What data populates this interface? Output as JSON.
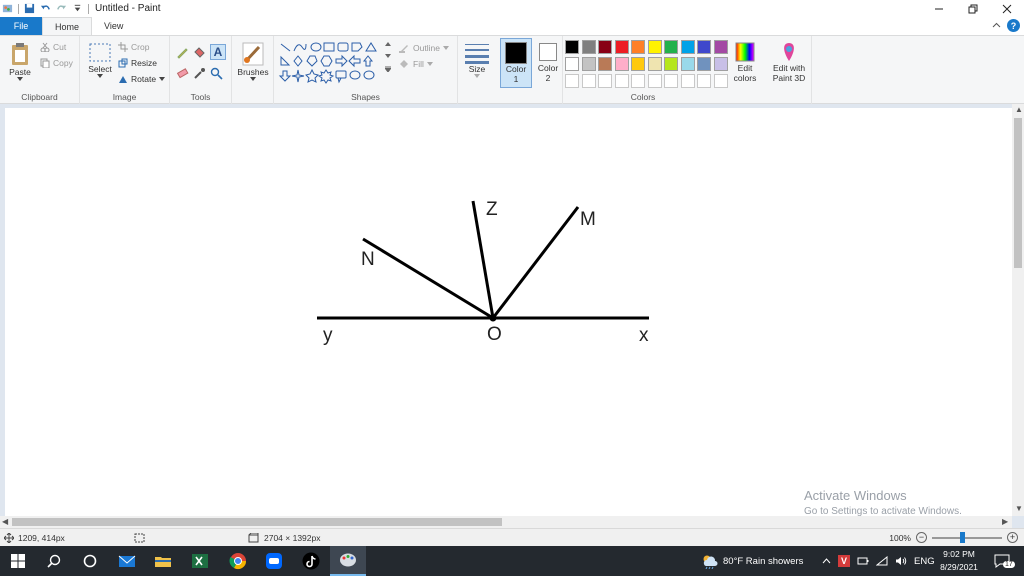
{
  "window": {
    "title": "Untitled - Paint",
    "controls": [
      "minimize-icon",
      "restore-icon",
      "close-icon"
    ]
  },
  "tabs": [
    {
      "label": "File"
    },
    {
      "label": "Home"
    },
    {
      "label": "View"
    }
  ],
  "ribbon": {
    "clipboard": {
      "paste": "Paste",
      "cut": "Cut",
      "copy": "Copy",
      "label": "Clipboard"
    },
    "image": {
      "select": "Select",
      "crop": "Crop",
      "resize": "Resize",
      "rotate": "Rotate",
      "label": "Image"
    },
    "tools": {
      "label": "Tools"
    },
    "brushes": {
      "label": "Brushes"
    },
    "shapes": {
      "outline": "Outline",
      "fill": "Fill",
      "label": "Shapes"
    },
    "size": {
      "label": "Size"
    },
    "color1": {
      "line1": "Color",
      "line2": "1",
      "color": "#000000"
    },
    "color2": {
      "line1": "Color",
      "line2": "2",
      "color": "#ffffff"
    },
    "colors": {
      "label": "Colors",
      "row1": [
        "#000000",
        "#7f7f7f",
        "#880015",
        "#ed1c24",
        "#ff7f27",
        "#fff200",
        "#22b14c",
        "#00a2e8",
        "#3f48cc",
        "#a349a4"
      ],
      "row2": [
        "#ffffff",
        "#c3c3c3",
        "#b97a57",
        "#ffaec9",
        "#ffc90e",
        "#efe4b0",
        "#b5e61d",
        "#99d9ea",
        "#7092be",
        "#c8bfe7"
      ]
    },
    "edit_colors": {
      "line1": "Edit",
      "line2": "colors"
    },
    "paint3d": {
      "line1": "Edit with",
      "line2": "Paint 3D"
    }
  },
  "drawing": {
    "labels": {
      "z": "Z",
      "m": "M",
      "n": "N",
      "y": "y",
      "o": "O",
      "x": "x"
    }
  },
  "watermark": {
    "line1": "Activate Windows",
    "line2": "Go to Settings to activate Windows."
  },
  "statusbar": {
    "cursor": "1209, 414px",
    "size": "2704 × 1392px",
    "zoom": "100%"
  },
  "taskbar": {
    "weather": "80°F  Rain showers",
    "lang": "ENG",
    "time": "9:02 PM",
    "date": "8/29/2021",
    "notifications": "17"
  }
}
